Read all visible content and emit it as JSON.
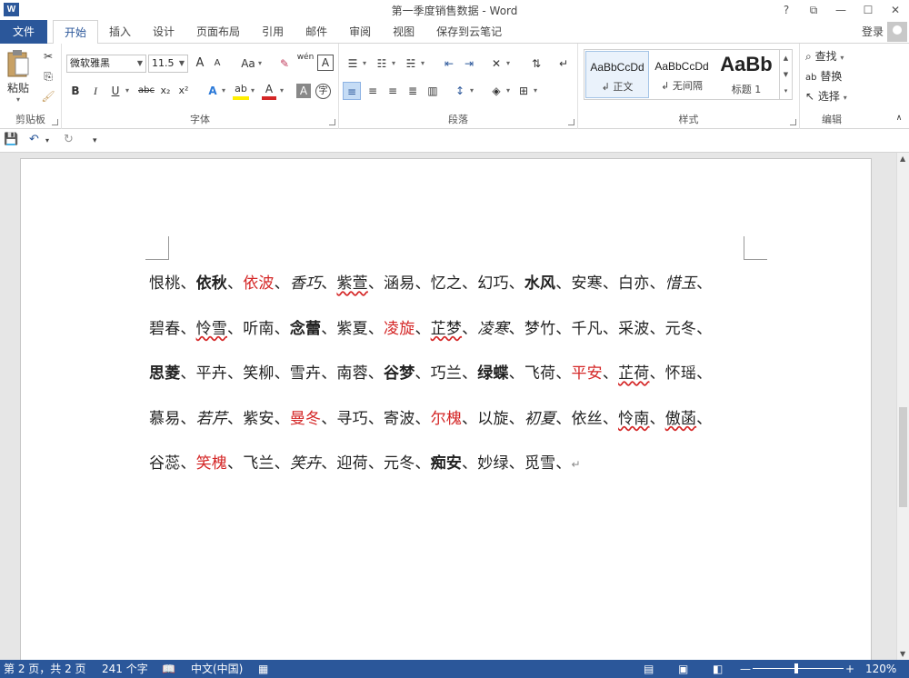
{
  "window": {
    "title": "第一季度销售数据 - Word",
    "logo": "W",
    "controls": [
      "?",
      "⧉",
      "—",
      "☐",
      "✕"
    ]
  },
  "tabs": {
    "file": "文件",
    "items": [
      "开始",
      "插入",
      "设计",
      "页面布局",
      "引用",
      "邮件",
      "审阅",
      "视图",
      "保存到云笔记"
    ],
    "active": "开始",
    "login": "登录"
  },
  "ribbon": {
    "clipboard": {
      "label": "剪贴板",
      "paste": "粘贴"
    },
    "font": {
      "label": "字体",
      "font_name": "微软雅黑",
      "font_size": "11.5",
      "grow": "A",
      "shrink": "A",
      "case": "Aa",
      "pinyin": "wén",
      "border": "A",
      "bold": "B",
      "italic": "I",
      "underline": "U",
      "strike": "abc",
      "subscript": "x₂",
      "superscript": "x²",
      "effects": "A",
      "highlight": "ab",
      "color": "A",
      "shading": "A",
      "enclose": "字"
    },
    "paragraph": {
      "label": "段落"
    },
    "styles": {
      "label": "样式",
      "items": [
        {
          "sample": "AaBbCcDd",
          "name": "正文"
        },
        {
          "sample": "AaBbCcDd",
          "name": "无间隔"
        },
        {
          "sample": "AaBb",
          "name": "标题 1"
        }
      ]
    },
    "editing": {
      "label": "编辑",
      "find": "查找",
      "replace": "替换",
      "select": "选择"
    }
  },
  "document": {
    "lines": [
      [
        {
          "t": "恨桃、"
        },
        {
          "t": "依秋",
          "s": "b"
        },
        {
          "t": "、"
        },
        {
          "t": "依波",
          "s": "r"
        },
        {
          "t": "、"
        },
        {
          "t": "香巧",
          "s": "i"
        },
        {
          "t": "、"
        },
        {
          "t": "紫萱",
          "s": "w"
        },
        {
          "t": "、涵易、忆之、幻巧、"
        },
        {
          "t": "水风",
          "s": "b"
        },
        {
          "t": "、安寒、白亦、"
        },
        {
          "t": "惜玉",
          "s": "i"
        },
        {
          "t": "、"
        }
      ],
      [
        {
          "t": "碧春、"
        },
        {
          "t": "怜雪",
          "s": "w"
        },
        {
          "t": "、听南、"
        },
        {
          "t": "念蕾",
          "s": "b"
        },
        {
          "t": "、紫夏、"
        },
        {
          "t": "凌旋",
          "s": "r"
        },
        {
          "t": "、"
        },
        {
          "t": "芷梦",
          "s": "w"
        },
        {
          "t": "、"
        },
        {
          "t": "凌寒",
          "s": "i"
        },
        {
          "t": "、梦竹、千凡、采波、元冬、"
        }
      ],
      [
        {
          "t": "思菱",
          "s": "b"
        },
        {
          "t": "、平卉、笑柳、雪卉、南蓉、"
        },
        {
          "t": "谷梦",
          "s": "b"
        },
        {
          "t": "、巧兰、"
        },
        {
          "t": "绿蝶",
          "s": "b"
        },
        {
          "t": "、飞荷、"
        },
        {
          "t": "平安",
          "s": "r"
        },
        {
          "t": "、"
        },
        {
          "t": "芷荷",
          "s": "w"
        },
        {
          "t": "、怀瑶、"
        }
      ],
      [
        {
          "t": "慕易、"
        },
        {
          "t": "若芹",
          "s": "i"
        },
        {
          "t": "、紫安、"
        },
        {
          "t": "曼冬",
          "s": "r"
        },
        {
          "t": "、寻巧、寄波、"
        },
        {
          "t": "尔槐",
          "s": "r"
        },
        {
          "t": "、以旋、"
        },
        {
          "t": "初夏",
          "s": "i"
        },
        {
          "t": "、依丝、"
        },
        {
          "t": "怜南",
          "s": "w"
        },
        {
          "t": "、"
        },
        {
          "t": "傲菡",
          "s": "w"
        },
        {
          "t": "、"
        }
      ],
      [
        {
          "t": "谷蕊、"
        },
        {
          "t": "笑槐",
          "s": "r"
        },
        {
          "t": "、飞兰、"
        },
        {
          "t": "笑卉",
          "s": "i"
        },
        {
          "t": "、迎荷、元冬、"
        },
        {
          "t": "痴安",
          "s": "b"
        },
        {
          "t": "、妙绿、觅雪、"
        }
      ]
    ],
    "pilcrow": "↵"
  },
  "statusbar": {
    "page": "第 2 页，共 2 页",
    "words": "241 个字",
    "language": "中文(中国)",
    "zoom_minus": "—",
    "zoom_plus": "+",
    "zoom": "120%",
    "zoom_level_pct": 46
  },
  "colors": {
    "accent": "#2b579a",
    "red_text": "#d42626"
  }
}
